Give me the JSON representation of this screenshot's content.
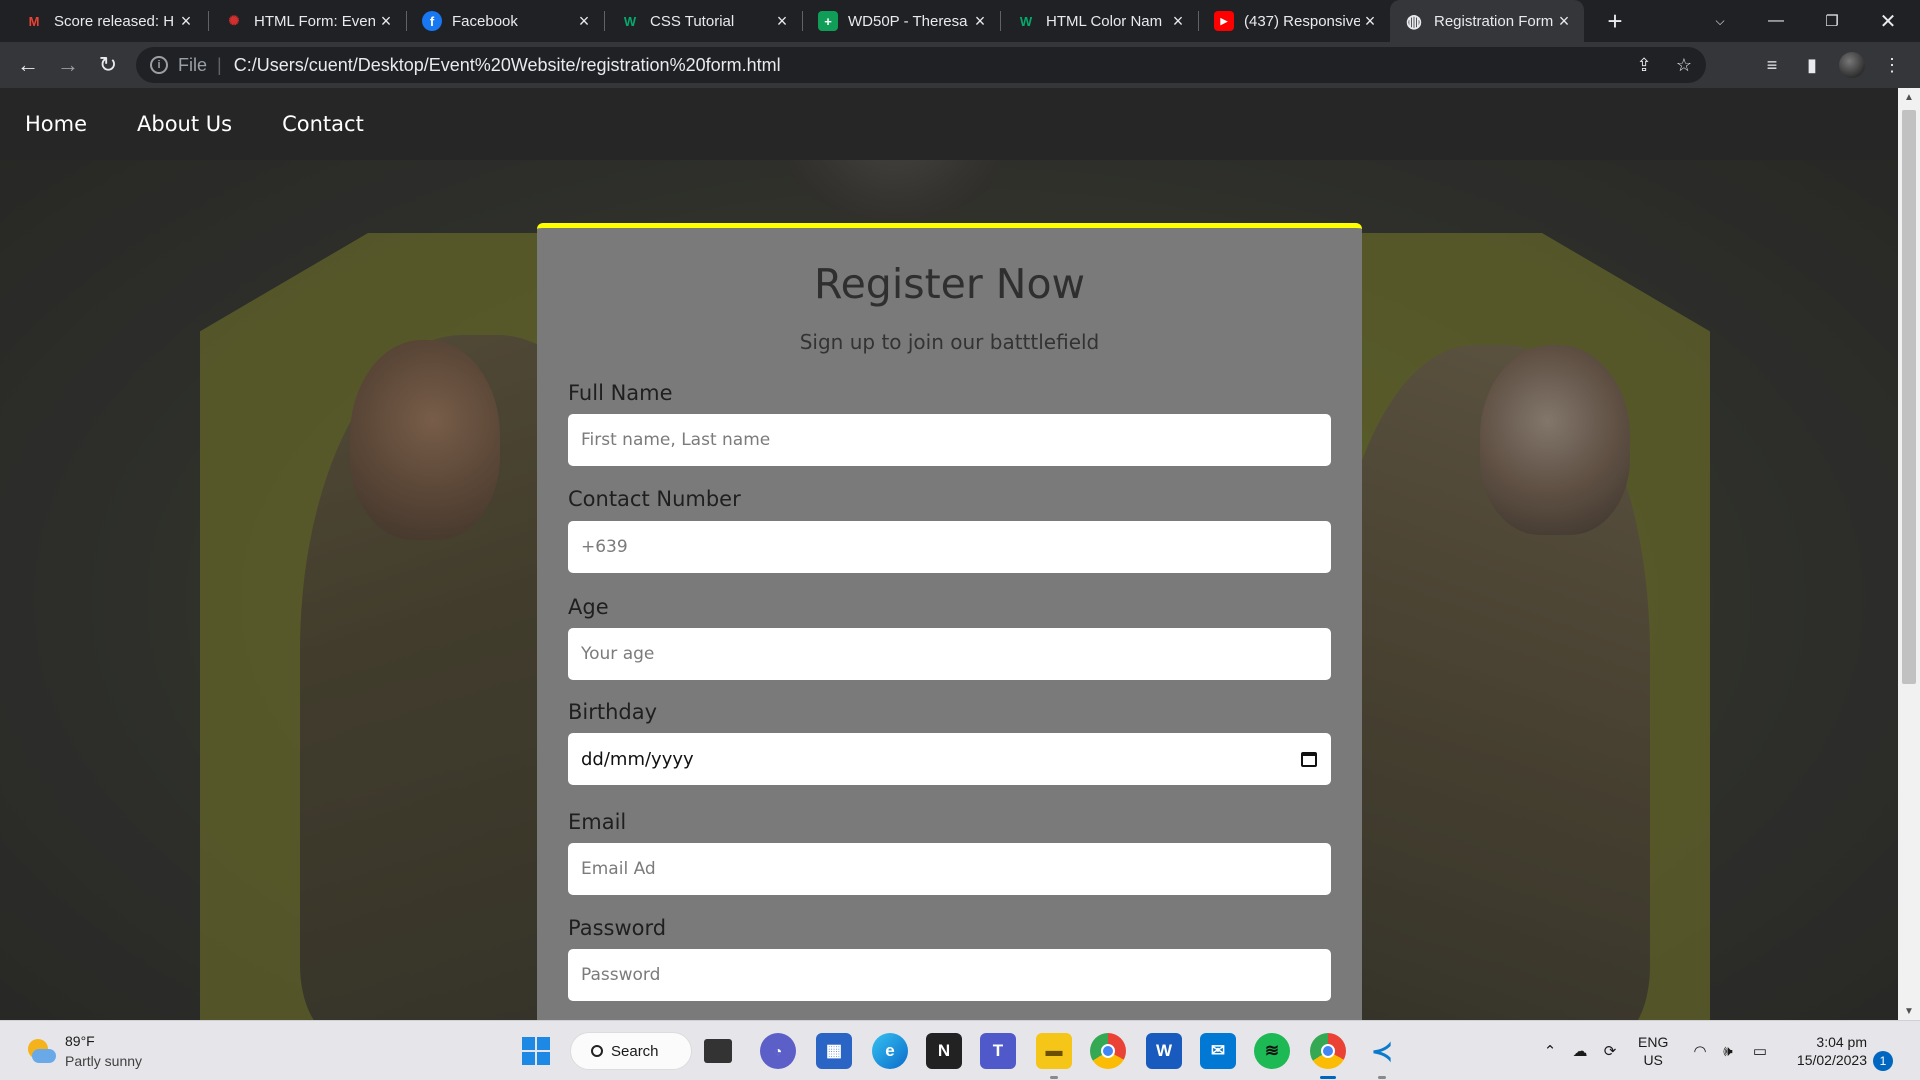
{
  "browser": {
    "tabs": [
      {
        "title": "Score released: H",
        "icon": "gmail-icon",
        "color": "#ea4335",
        "glyph": "M"
      },
      {
        "title": "HTML Form: Even",
        "icon": "html-form-icon",
        "color": "#d32f2f",
        "glyph": "✺"
      },
      {
        "title": "Facebook",
        "icon": "facebook-icon",
        "color": "#1877f2",
        "glyph": "f"
      },
      {
        "title": "CSS Tutorial",
        "icon": "w3schools-icon",
        "color": "#04aa6d",
        "glyph": "W"
      },
      {
        "title": "WD50P - Theresa",
        "icon": "sheets-icon",
        "color": "#0f9d58",
        "glyph": "+"
      },
      {
        "title": "HTML Color Nam",
        "icon": "w3schools-icon",
        "color": "#04aa6d",
        "glyph": "W"
      },
      {
        "title": "(437) Responsive",
        "icon": "youtube-icon",
        "color": "#ff0000",
        "glyph": "▶"
      },
      {
        "title": "Registration Form",
        "icon": "globe-icon",
        "color": "#e8eaed",
        "glyph": "◍",
        "active": true
      }
    ],
    "address": {
      "scheme": "File",
      "url": "C:/Users/cuent/Desktop/Event%20Website/registration%20form.html"
    }
  },
  "site": {
    "nav": [
      "Home",
      "About Us",
      "Contact"
    ]
  },
  "form": {
    "title": "Register Now",
    "subtitle": "Sign up to join our batttlefield",
    "fields": [
      {
        "label": "Full Name",
        "placeholder": "First name, Last name"
      },
      {
        "label": "Contact Number",
        "placeholder": "+639"
      },
      {
        "label": "Age",
        "placeholder": "Your age"
      },
      {
        "label": "Birthday",
        "placeholder": "dd/mm/yyyy"
      },
      {
        "label": "Email",
        "placeholder": "Email Ad"
      },
      {
        "label": "Password",
        "placeholder": "Password"
      }
    ],
    "accent_color": "#ffff00"
  },
  "taskbar": {
    "weather": {
      "temp": "89°F",
      "desc": "Partly sunny"
    },
    "search_label": "Search",
    "apps": [
      "start",
      "search",
      "task-view",
      "chat",
      "store",
      "edge",
      "notion",
      "teams",
      "file-explorer",
      "chrome",
      "word",
      "mail",
      "spotify",
      "chrome-profile",
      "vscode"
    ],
    "language": {
      "lang": "ENG",
      "region": "US"
    },
    "clock": {
      "time": "3:04 pm",
      "date": "15/02/2023"
    },
    "notifications": "1"
  }
}
